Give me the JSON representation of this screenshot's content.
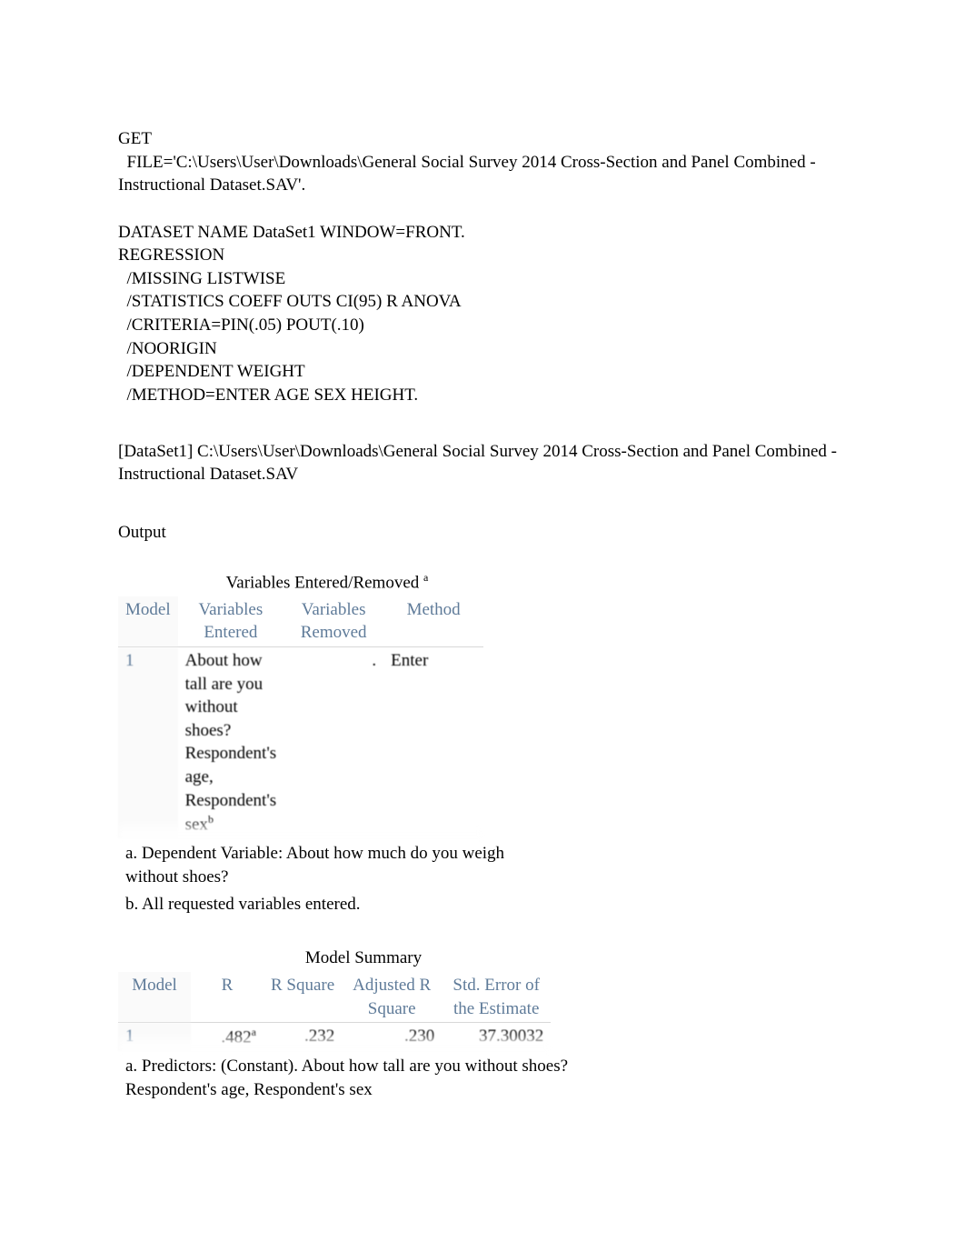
{
  "syntax": "GET\n  FILE='C:\\Users\\User\\Downloads\\General Social Survey 2014 Cross-Section and Panel Combined - Instructional Dataset.SAV'.\n\nDATASET NAME DataSet1 WINDOW=FRONT.\nREGRESSION\n  /MISSING LISTWISE\n  /STATISTICS COEFF OUTS CI(95) R ANOVA\n  /CRITERIA=PIN(.05) POUT(.10)\n  /NOORIGIN\n  /DEPENDENT WEIGHT\n  /METHOD=ENTER AGE SEX HEIGHT.",
  "dataset_line": "[DataSet1] C:\\Users\\User\\Downloads\\General Social Survey 2014 Cross-Section and Panel Combined - Instructional Dataset.SAV",
  "output_heading": "Output",
  "tables": {
    "vars": {
      "title": "Variables Entered/Removed",
      "title_sup": "a",
      "headers": {
        "model": "Model",
        "entered": "Variables Entered",
        "removed": "Variables Removed",
        "method": "Method"
      },
      "row": {
        "model": "1",
        "entered": "About how tall are you without shoes? Respondent's age, Respondent's sex",
        "entered_sup": "b",
        "removed": ".",
        "method": "Enter"
      },
      "footnote_a": "a. Dependent Variable: About how much do you weigh without shoes?",
      "footnote_b": "b. All requested variables entered."
    },
    "summary": {
      "title": "Model Summary",
      "headers": {
        "model": "Model",
        "r": "R",
        "rsq": "R Square",
        "adjrsq": "Adjusted R Square",
        "stderr": "Std. Error of the Estimate"
      },
      "row": {
        "model": "1",
        "r": ".482",
        "r_sup": "a",
        "rsq": ".232",
        "adjrsq": ".230",
        "stderr": "37.30032"
      },
      "footnote_a": "a. Predictors: (Constant). About how tall are you without shoes? Respondent's age, Respondent's sex"
    }
  },
  "chart_data": [
    {
      "type": "table",
      "title": "Variables Entered/Removed",
      "columns": [
        "Model",
        "Variables Entered",
        "Variables Removed",
        "Method"
      ],
      "rows": [
        [
          "1",
          "About how tall are you without shoes? Respondent's age, Respondent's sex",
          ".",
          "Enter"
        ]
      ],
      "notes": [
        "a. Dependent Variable: About how much do you weigh without shoes?",
        "b. All requested variables entered."
      ]
    },
    {
      "type": "table",
      "title": "Model Summary",
      "columns": [
        "Model",
        "R",
        "R Square",
        "Adjusted R Square",
        "Std. Error of the Estimate"
      ],
      "rows": [
        [
          "1",
          ".482",
          ".232",
          ".230",
          "37.30032"
        ]
      ],
      "notes": [
        "a. Predictors: (Constant). About how tall are you without shoes? Respondent's age, Respondent's sex"
      ]
    }
  ]
}
